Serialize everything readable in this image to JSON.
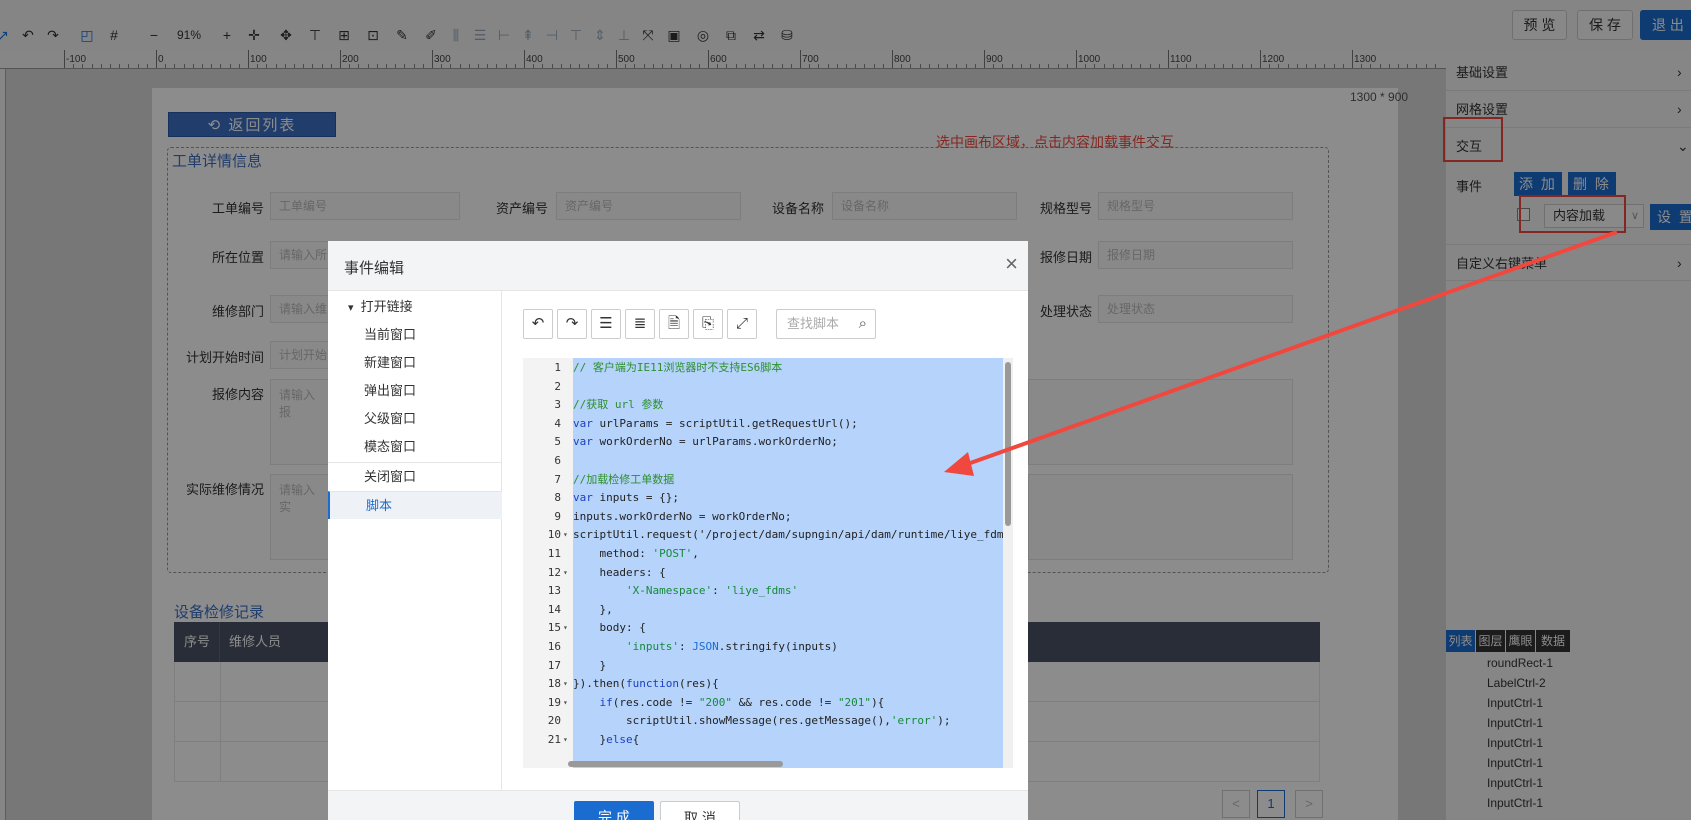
{
  "toolbar": {
    "zoom": "91%",
    "preview_label": "预 览",
    "save_label": "保 存",
    "exit_label": "退 出"
  },
  "ruler": {
    "ticks": [
      "-100",
      "0",
      "100",
      "200",
      "300",
      "400",
      "500",
      "600",
      "700",
      "800",
      "900",
      "1000",
      "1100",
      "1200",
      "1300"
    ]
  },
  "canvas": {
    "size_label": "1300 * 900",
    "back_button": "返回列表",
    "detail_title": "工单详情信息",
    "hint": "选中画布区域，点击内容加载事件交互",
    "fields": [
      {
        "label": "工单编号",
        "placeholder": "工单编号"
      },
      {
        "label": "资产编号",
        "placeholder": "资产编号"
      },
      {
        "label": "设备名称",
        "placeholder": "设备名称"
      },
      {
        "label": "规格型号",
        "placeholder": "规格型号"
      },
      {
        "label": "所在位置",
        "placeholder": "请输入所"
      },
      {
        "label": "报修日期",
        "placeholder": "报修日期"
      },
      {
        "label": "维修部门",
        "placeholder": "请输入维"
      },
      {
        "label": "处理状态",
        "placeholder": "处理状态"
      },
      {
        "label": "计划开始时间",
        "placeholder": "计划开始"
      },
      {
        "label": "报修内容",
        "placeholder": "请输入报"
      },
      {
        "label": "实际维修情况",
        "placeholder": "请输入实"
      }
    ],
    "records_title": "设备检修记录",
    "records_columns": [
      "序号",
      "维修人员"
    ],
    "pager_prev": "<",
    "pager_current": "1",
    "pager_next": ">"
  },
  "right_panel": {
    "sections": [
      "基础设置",
      "网格设置",
      "交互",
      "自定义右键菜单"
    ],
    "event_label": "事件",
    "add_label": "添 加",
    "delete_label": "删 除",
    "event_select": "内容加载",
    "setting_label": "设 置",
    "layer_tabs": [
      "列表",
      "图层",
      "鹰眼",
      "数据"
    ],
    "layer_items": [
      "roundRect-1",
      "LabelCtrl-2",
      "InputCtrl-1",
      "InputCtrl-1",
      "InputCtrl-1",
      "InputCtrl-1",
      "InputCtrl-1",
      "InputCtrl-1"
    ]
  },
  "modal": {
    "title": "事件编辑",
    "close": "×",
    "events": [
      {
        "label": "打开链接",
        "type": "group"
      },
      {
        "label": "当前窗口",
        "type": "child"
      },
      {
        "label": "新建窗口",
        "type": "child"
      },
      {
        "label": "弹出窗口",
        "type": "child"
      },
      {
        "label": "父级窗口",
        "type": "child"
      },
      {
        "label": "模态窗口",
        "type": "child"
      },
      {
        "label": "关闭窗口",
        "type": "item"
      },
      {
        "label": "脚本",
        "type": "selected"
      }
    ],
    "search_placeholder": "查找脚本",
    "code_lines": [
      "// 客户端为IE11浏览器时不支持ES6脚本",
      "",
      "//获取 url 参数",
      "var urlParams = scriptUtil.getRequestUrl();",
      "var workOrderNo = urlParams.workOrderNo;",
      "",
      "//加载检修工单数据",
      "var inputs = {};",
      "inputs.workOrderNo = workOrderNo;",
      "scriptUtil.request('/project/dam/supngin/api/dam/runtime/liye_fdm",
      "    method: 'POST',",
      "    headers: {",
      "        'X-Namespace': 'liye_fdms'",
      "    },",
      "    body: {",
      "        'inputs': JSON.stringify(inputs)",
      "    }",
      "}).then(function(res){",
      "    if(res.code != \"200\" && res.code != \"201\"){",
      "        scriptUtil.showMessage(res.getMessage(),'error');",
      "    }else{"
    ],
    "fold_lines": [
      10,
      12,
      15,
      18,
      19,
      21
    ],
    "confirm_label": "完 成",
    "cancel_label": "取 消"
  },
  "colors": {
    "accent": "#1a6cd0",
    "annotation_red": "#f0483e",
    "selection": "#b5d3fb",
    "table_header": "#4a5366"
  }
}
